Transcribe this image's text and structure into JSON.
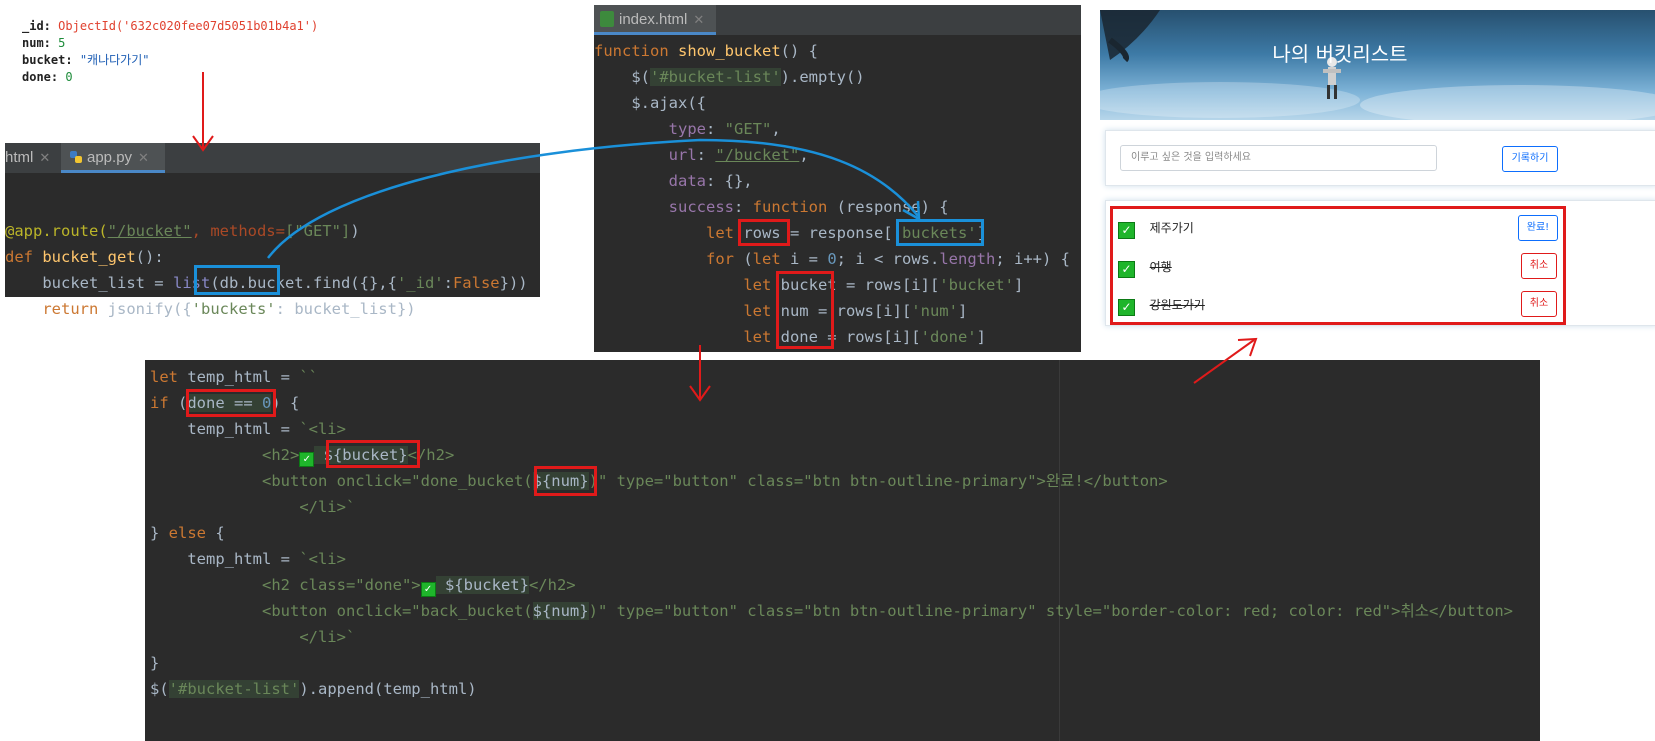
{
  "mongo_doc": {
    "id_key": "_id:",
    "id_value": "ObjectId('632c020fee07d5051b01b4a1')",
    "num_key": "num:",
    "num_value": "5",
    "bucket_key": "bucket:",
    "bucket_value": "\"캐나다가기\"",
    "done_key": "done:",
    "done_value": "0"
  },
  "app_py": {
    "tab_left": "html",
    "tab_active": "app.py",
    "lines": [
      {
        "a": "@app.route(",
        "b": "\"/bucket\"",
        "c": ", methods=",
        "d": "[\"GET\"]",
        "e": ")"
      },
      {
        "a": "def ",
        "b": "bucket_get",
        "c": "():"
      },
      {
        "a": "    bucket_list = ",
        "b": "list",
        "c": "(db.bucket.find({},{",
        "d": "'_id'",
        "e": ":",
        "f": "False",
        "g": "}))"
      },
      {
        "a": "    ",
        "b": "return",
        "c": " jsonify({",
        "d": "'buckets'",
        "e": ": bucket_list})"
      }
    ]
  },
  "index_html": {
    "tab": "index.html",
    "lines": [
      {
        "a": "function ",
        "b": "show_bucket",
        "c": "() {"
      },
      {
        "a": "    $(",
        "b": "'#bucket-list'",
        "c": ").empty()"
      },
      {
        "a": "    $.ajax({"
      },
      {
        "a": "        ",
        "b": "type",
        "c": ": ",
        "d": "\"GET\"",
        "e": ","
      },
      {
        "a": "        ",
        "b": "url",
        "c": ": ",
        "d": "\"/bucket\"",
        "e": ","
      },
      {
        "a": "        ",
        "b": "data",
        "c": ": {},"
      },
      {
        "a": "        ",
        "b": "success",
        "c": ": ",
        "d": "function",
        "e": " (response) {"
      },
      {
        "a": "            ",
        "b": "let",
        "c": " rows = response[",
        "d": "'buckets'",
        "e": "]"
      },
      {
        "a": "            ",
        "b": "for",
        "c": " (",
        "d": "let",
        "e": " i = ",
        "f": "0",
        "g": "; i < rows.",
        "h": "length",
        "i": "; i++) {"
      },
      {
        "a": "                ",
        "b": "let",
        "c": " bucket = rows[i][",
        "d": "'bucket'",
        "e": "]"
      },
      {
        "a": "                ",
        "b": "let",
        "c": " num = rows[i][",
        "d": "'num'",
        "e": "]"
      },
      {
        "a": "                ",
        "b": "let",
        "c": " done = rows[i][",
        "d": "'done'",
        "e": "]"
      }
    ]
  },
  "template_code": {
    "lines": [
      {
        "a": "let",
        "b": " temp_html = ",
        "c": "``"
      },
      {
        "a": "if",
        "b": " (",
        "c": "done == ",
        "d": "0",
        "e": ") {"
      },
      {
        "a": "    temp_html = ",
        "b": "`<li>"
      },
      {
        "a": "            ",
        "b": "<h2>",
        "c": "✅",
        "d": " ${bucket}",
        "e": "</h2>"
      },
      {
        "a": "            ",
        "b": "<button onclick=\"done_bucket(",
        "c": "${num}",
        "d": ")\" type=\"button\" class=\"btn btn-outline-primary\">완료!</button>"
      },
      {
        "a": "                ",
        "b": "</li>`"
      },
      {
        "a": "} ",
        "b": "else",
        "c": " {"
      },
      {
        "a": "    temp_html = ",
        "b": "`<li>"
      },
      {
        "a": "            ",
        "b": "<h2 class=\"done\">",
        "c": "✅",
        "d": " ${bucket}",
        "e": "</h2>"
      },
      {
        "a": "            ",
        "b": "<button onclick=\"back_bucket(",
        "c": "${num}",
        "d": ")\" type=\"button\" class=\"btn btn-outline-primary\" style=\"border-color: red; color: red\">취소</button>"
      },
      {
        "a": "                ",
        "b": "</li>`"
      },
      {
        "a": "}"
      },
      {
        "a": "$(",
        "b": "'#bucket-list'",
        "c": ").append(temp_html)"
      }
    ]
  },
  "webapp": {
    "title": "나의 버킷리스트",
    "input_placeholder": "이루고 싶은 것을 입력하세요",
    "record_button": "기록하기",
    "items": [
      {
        "text": "제주가기",
        "button": "완료!",
        "done": false
      },
      {
        "text": "여행",
        "button": "취소",
        "done": true
      },
      {
        "text": "강원도가기",
        "button": "취소",
        "done": true
      }
    ],
    "check_glyph": "✓"
  },
  "colors": {
    "annotation_red": "#e01a1a",
    "annotation_blue": "#1a90d9",
    "ide_bg": "#2b2b2b"
  }
}
